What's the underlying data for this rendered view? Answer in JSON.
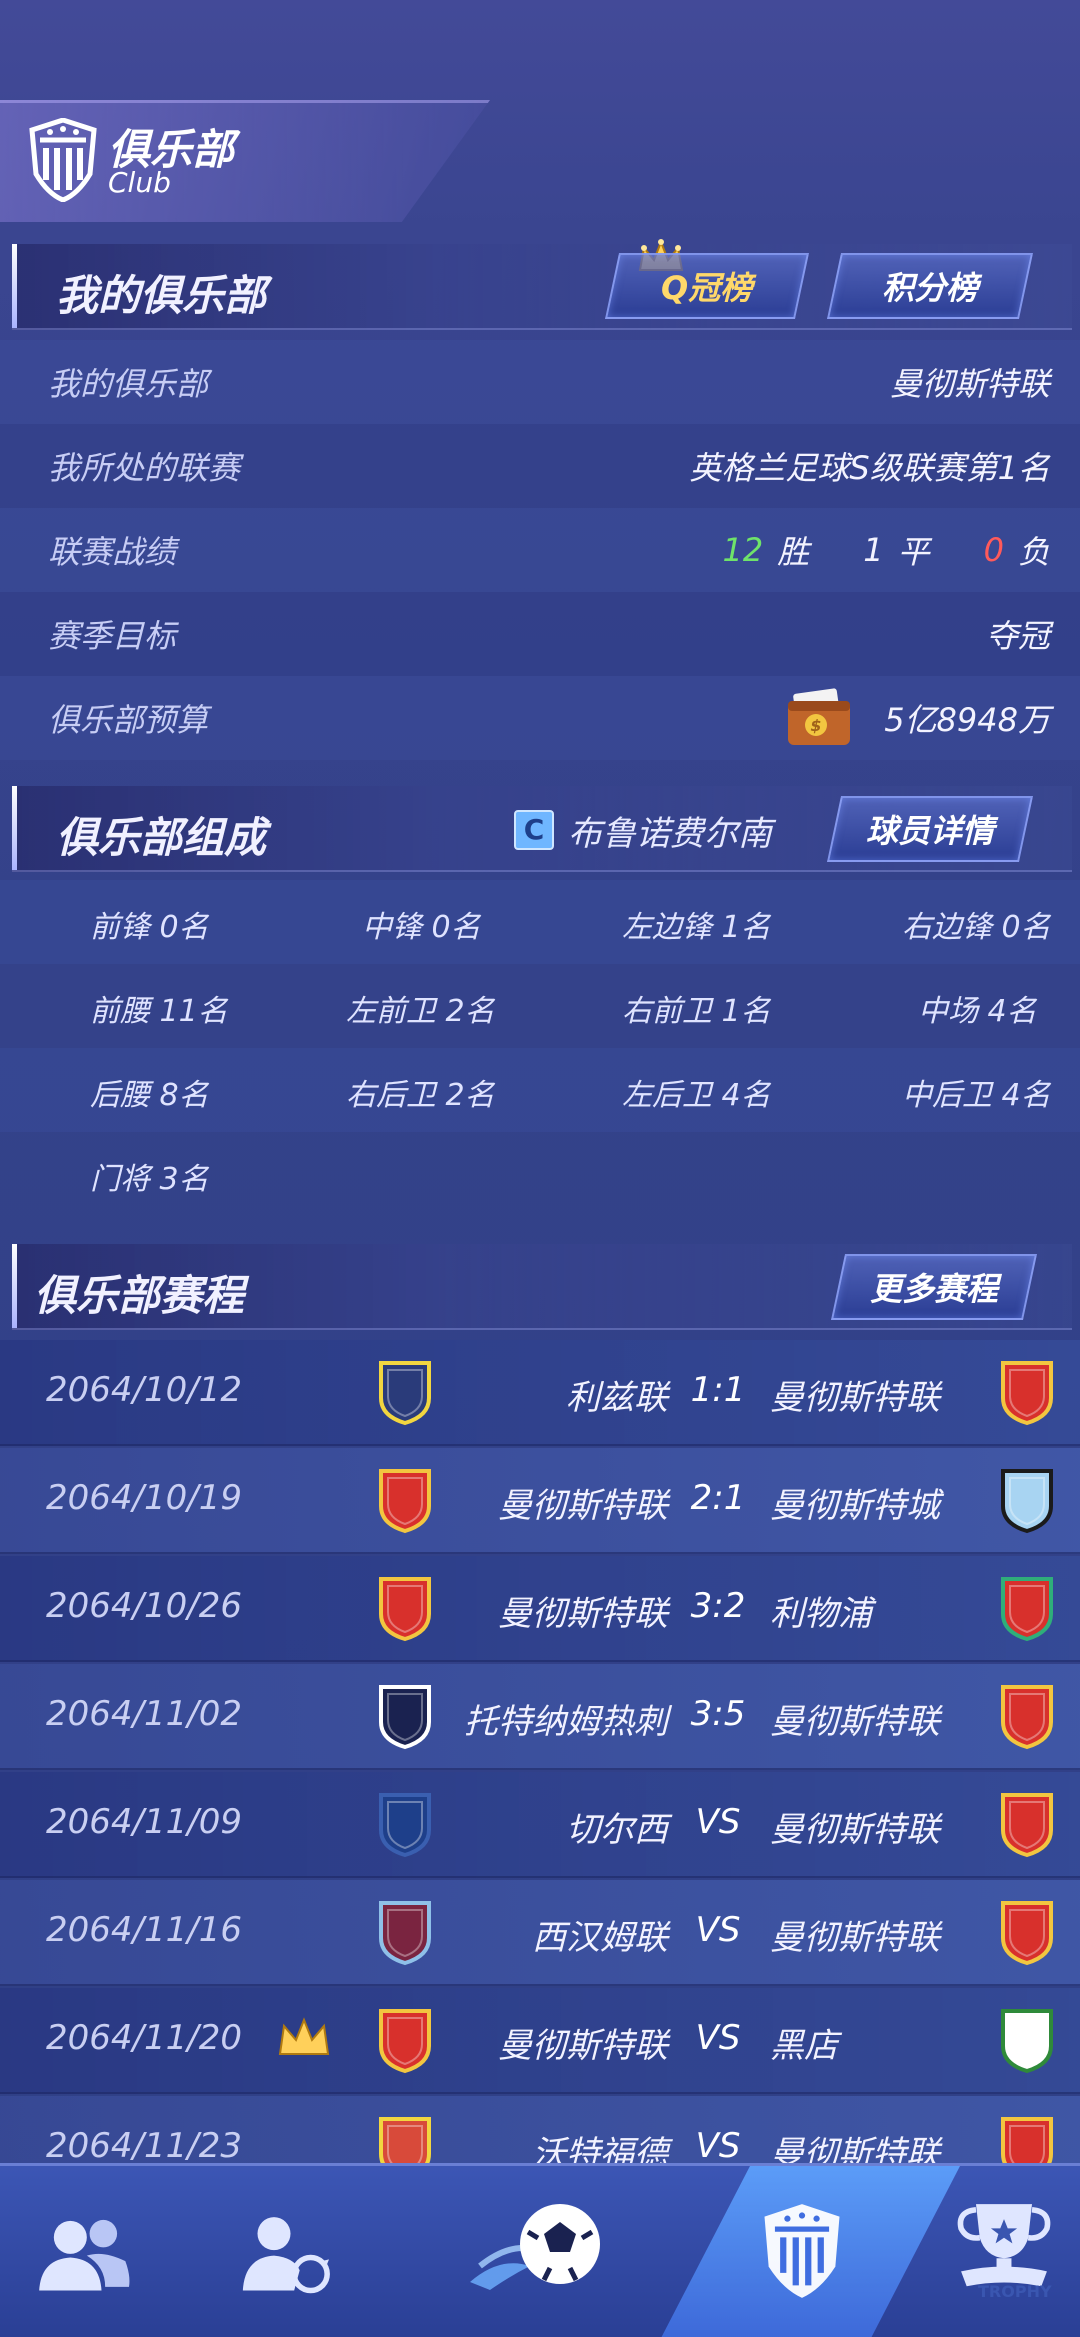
{
  "header": {
    "title": "俱乐部",
    "subtitle": "Club"
  },
  "my_club": {
    "title": "我的俱乐部",
    "q_rank_button": "Q冠榜",
    "points_button": "积分榜",
    "rows": [
      {
        "label": "我的俱乐部",
        "value": "曼彻斯特联"
      },
      {
        "label": "我所处的联赛",
        "value": "英格兰足球S级联赛第1名"
      },
      {
        "label": "联赛战绩",
        "wins": "12",
        "wins_label": "胜",
        "draws": "1",
        "draws_label": "平",
        "losses": "0",
        "losses_label": "负"
      },
      {
        "label": "赛季目标",
        "value": "夺冠"
      },
      {
        "label": "俱乐部预算",
        "value": "5亿8948万"
      }
    ]
  },
  "composition": {
    "title": "俱乐部组成",
    "coach_badge": "C",
    "coach": "布鲁诺费尔南",
    "details_button": "球员详情",
    "rows": [
      [
        "前锋  0名",
        "中锋  0名",
        "左边锋 1名",
        "右边锋 0名"
      ],
      [
        "前腰  11名",
        "左前卫 2名",
        "右前卫 1名",
        "中场  4名"
      ],
      [
        "后腰  8名",
        "右后卫 2名",
        "左后卫 4名",
        "中后卫 4名"
      ],
      [
        "门将  3名"
      ]
    ]
  },
  "schedule": {
    "title": "俱乐部赛程",
    "more_button": "更多赛程",
    "matches": [
      {
        "date": "2064/10/12",
        "home": "利兹联",
        "score": "1:1",
        "away": "曼彻斯特联",
        "home_color": "#2a3b7a",
        "home_accent": "#f2d640",
        "away_color": "#d8302c",
        "away_accent": "#f2c640",
        "crown": false
      },
      {
        "date": "2064/10/19",
        "home": "曼彻斯特联",
        "score": "2:1",
        "away": "曼彻斯特城",
        "home_color": "#d8302c",
        "home_accent": "#f2c640",
        "away_color": "#a8d4f2",
        "away_accent": "#1b1b1b",
        "crown": false
      },
      {
        "date": "2064/10/26",
        "home": "曼彻斯特联",
        "score": "3:2",
        "away": "利物浦",
        "home_color": "#d8302c",
        "home_accent": "#f2c640",
        "away_color": "#d8302c",
        "away_accent": "#2fae7a",
        "crown": false
      },
      {
        "date": "2064/11/02",
        "home": "托特纳姆热刺",
        "score": "3:5",
        "away": "曼彻斯特联",
        "home_color": "#1a2250",
        "home_accent": "#ffffff",
        "away_color": "#d8302c",
        "away_accent": "#f2c640",
        "crown": false
      },
      {
        "date": "2064/11/09",
        "home": "切尔西",
        "score": "VS",
        "away": "曼彻斯特联",
        "home_color": "#1e3f8a",
        "home_accent": "#3a5fb0",
        "away_color": "#d8302c",
        "away_accent": "#f2c640",
        "crown": false
      },
      {
        "date": "2064/11/16",
        "home": "西汉姆联",
        "score": "VS",
        "away": "曼彻斯特联",
        "home_color": "#7a2440",
        "home_accent": "#8fc0e8",
        "away_color": "#d8302c",
        "away_accent": "#f2c640",
        "crown": false
      },
      {
        "date": "2064/11/20",
        "home": "曼彻斯特联",
        "score": "VS",
        "away": "黑店",
        "home_color": "#d8302c",
        "home_accent": "#f2c640",
        "away_color": "#ffffff",
        "away_accent": "#2f8a3a",
        "crown": true
      },
      {
        "date": "2064/11/23",
        "home": "沃特福德",
        "score": "VS",
        "away": "曼彻斯特联",
        "home_color": "#d84a3a",
        "home_accent": "#f2d640",
        "away_color": "#d8302c",
        "away_accent": "#f2c640",
        "crown": false
      }
    ]
  },
  "bottom_nav": {
    "items": [
      {
        "icon": "players-icon"
      },
      {
        "icon": "transfer-icon"
      },
      {
        "icon": "match-ball-icon"
      },
      {
        "icon": "club-icon",
        "active": true
      },
      {
        "icon": "trophy-icon",
        "label": "TROPHY"
      }
    ]
  },
  "colors": {
    "accent": "#ffd86a",
    "win": "#6fe36a",
    "loss": "#ff5a5a"
  }
}
